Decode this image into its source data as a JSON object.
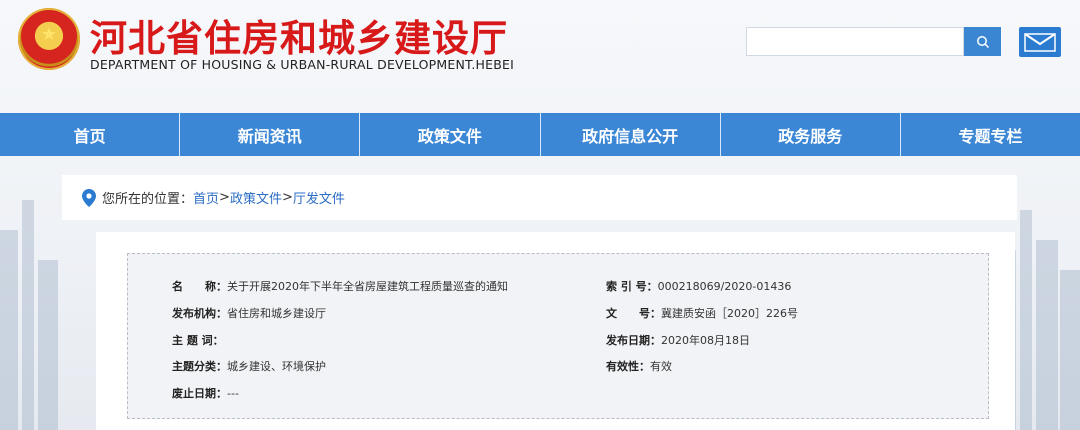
{
  "header": {
    "title": "河北省住房和城乡建设厅",
    "subtitle": "DEPARTMENT OF HOUSING & URBAN-RURAL DEVELOPMENT.HEBEI",
    "search_placeholder": "",
    "search_icon": "search-icon",
    "mail_icon": "mail-icon"
  },
  "nav": {
    "items": [
      {
        "label": "首页"
      },
      {
        "label": "新闻资讯"
      },
      {
        "label": "政策文件"
      },
      {
        "label": "政府信息公开"
      },
      {
        "label": "政务服务"
      },
      {
        "label": "专题专栏"
      }
    ]
  },
  "breadcrumb": {
    "prefix": "您所在的位置：",
    "links": [
      "首页",
      "政策文件",
      "厅发文件"
    ],
    "separator": ">"
  },
  "meta": {
    "name_key": "名　　称：",
    "name_val": "关于开展2020年下半年全省房屋建筑工程质量巡查的通知",
    "index_key": "索 引 号：",
    "index_val": "000218069/2020-01436",
    "org_key": "发布机构：",
    "org_val": "省住房和城乡建设厅",
    "doc_key": "文　　号：",
    "doc_val": "冀建质安函［2020］226号",
    "subject_key": "主 题 词：",
    "subject_val": "",
    "date_key": "发布日期：",
    "date_val": "2020年08月18日",
    "category_key": "主题分类：",
    "category_val": "城乡建设、环境保护",
    "valid_key": "有效性：",
    "valid_val": "有效",
    "expire_key": "废止日期：",
    "expire_val": "---"
  },
  "colors": {
    "title_red": "#d7191a",
    "nav_blue": "#3b87d6",
    "link_blue": "#2b6cc4"
  }
}
